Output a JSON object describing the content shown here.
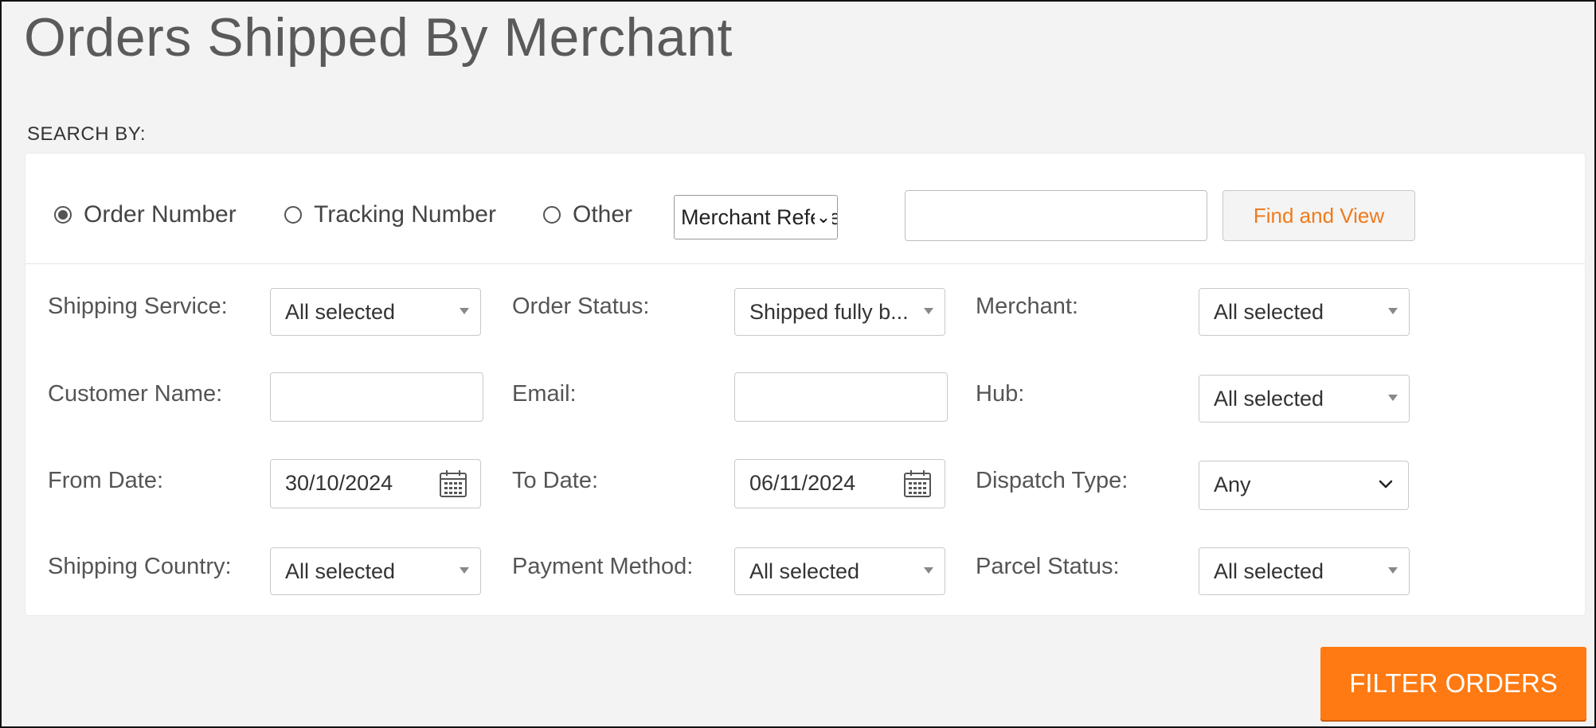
{
  "page": {
    "title": "Orders Shipped By Merchant"
  },
  "search": {
    "heading": "SEARCH BY:",
    "radios": [
      {
        "label": "Order Number",
        "checked": true
      },
      {
        "label": "Tracking Number",
        "checked": false
      },
      {
        "label": "Other",
        "checked": false
      }
    ],
    "reference_select": "Merchant Refere",
    "search_value": "",
    "find_button": "Find and View"
  },
  "filters": {
    "shipping_service": {
      "label": "Shipping Service:",
      "value": "All selected"
    },
    "order_status": {
      "label": "Order Status:",
      "value": "Shipped fully b..."
    },
    "merchant": {
      "label": "Merchant:",
      "value": "All selected"
    },
    "customer_name": {
      "label": "Customer Name:",
      "value": ""
    },
    "email": {
      "label": "Email:",
      "value": ""
    },
    "hub": {
      "label": "Hub:",
      "value": "All selected"
    },
    "from_date": {
      "label": "From Date:",
      "value": "30/10/2024"
    },
    "to_date": {
      "label": "To Date:",
      "value": "06/11/2024"
    },
    "dispatch_type": {
      "label": "Dispatch Type:",
      "value": "Any"
    },
    "shipping_country": {
      "label": "Shipping Country:",
      "value": "All selected"
    },
    "payment_method": {
      "label": "Payment Method:",
      "value": "All selected"
    },
    "parcel_status": {
      "label": "Parcel Status:",
      "value": "All selected"
    }
  },
  "actions": {
    "filter_button": "FILTER ORDERS"
  },
  "colors": {
    "accent": "#ff7a12",
    "find_text": "#f07a1a",
    "page_bg": "#f3f3f3"
  },
  "icons": {
    "date": "calendar-icon",
    "dropdown": "dropdown-arrow-icon",
    "select": "chevron-down-icon"
  }
}
